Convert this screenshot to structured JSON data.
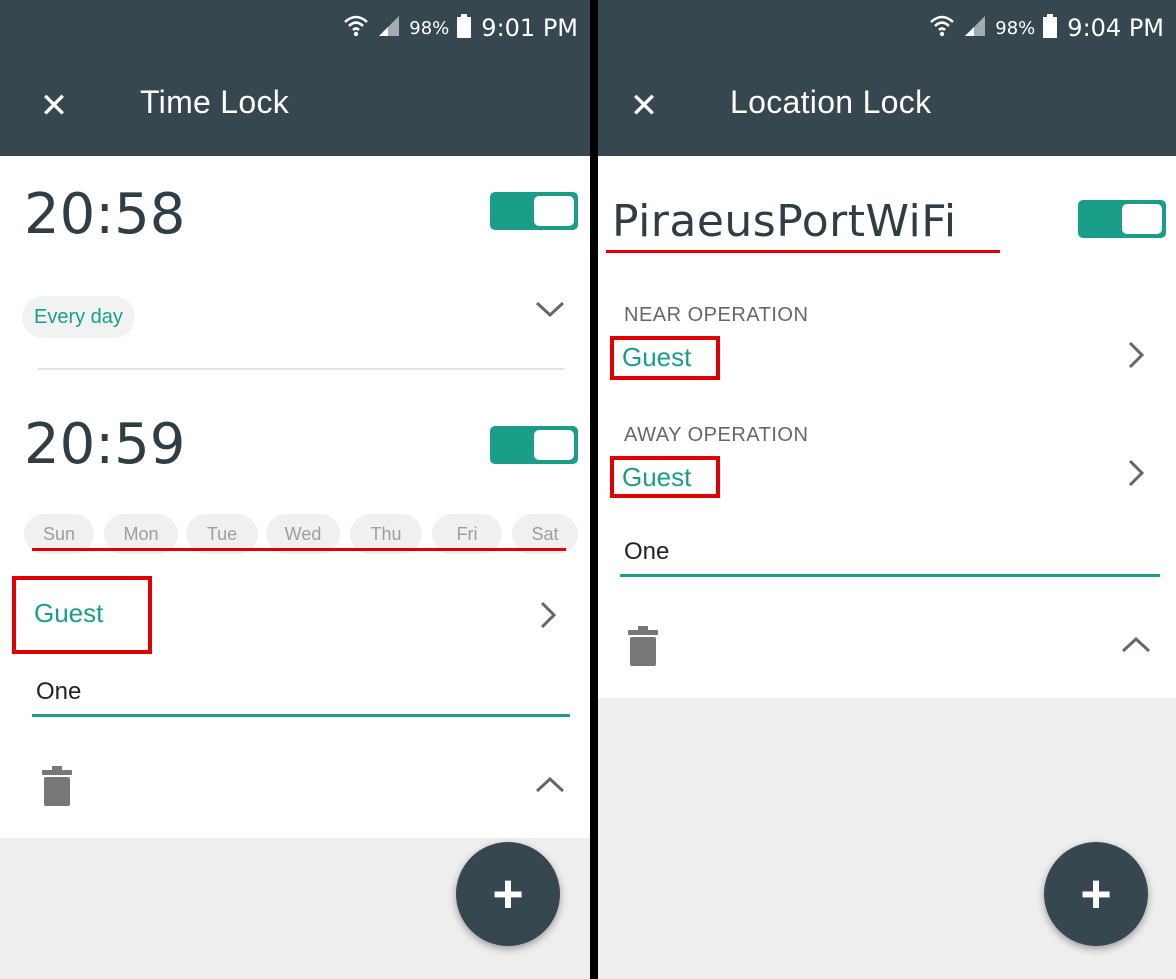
{
  "status_bar_left": {
    "battery": "98%",
    "clock": "9:01 PM"
  },
  "status_bar_right": {
    "battery": "98%",
    "clock": "9:04 PM"
  },
  "time_lock": {
    "title": "Time Lock",
    "entry1": {
      "time": "20:58",
      "enabled": true,
      "repeat": "Every day"
    },
    "entry2": {
      "time": "20:59",
      "enabled": true,
      "days": [
        "Sun",
        "Mon",
        "Tue",
        "Wed",
        "Thu",
        "Fri",
        "Sat"
      ],
      "operation": "Guest",
      "name": "One"
    }
  },
  "location_lock": {
    "title": "Location Lock",
    "network": "PiraeusPortWiFi",
    "enabled": true,
    "near_label": "NEAR OPERATION",
    "near_value": "Guest",
    "away_label": "AWAY OPERATION",
    "away_value": "Guest",
    "name": "One"
  },
  "icons": [
    "close-icon",
    "wifi-icon",
    "signal-icon",
    "battery-icon",
    "chevron-down-icon",
    "chevron-right-icon",
    "chevron-up-icon",
    "trash-icon",
    "plus-icon"
  ],
  "colors": {
    "appbar": "#37474f",
    "accent": "#1a9e8a",
    "highlight": "#e00000"
  }
}
